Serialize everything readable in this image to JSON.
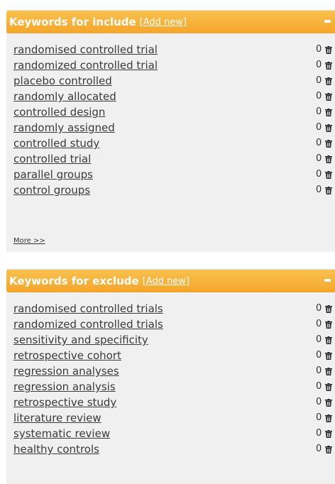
{
  "include_panel": {
    "title": "Keywords for include",
    "add_new_label": "Add new",
    "more_label": "More >>",
    "keywords": [
      {
        "label": "randomised controlled trial",
        "count": "0"
      },
      {
        "label": "randomized controlled trial",
        "count": "0"
      },
      {
        "label": "placebo controlled",
        "count": "0"
      },
      {
        "label": "randomly allocated",
        "count": "0"
      },
      {
        "label": "controlled design",
        "count": "0"
      },
      {
        "label": "randomly assigned",
        "count": "0"
      },
      {
        "label": "controlled study",
        "count": "0"
      },
      {
        "label": "controlled trial",
        "count": "0"
      },
      {
        "label": "parallel groups",
        "count": "0"
      },
      {
        "label": "control groups",
        "count": "0"
      }
    ]
  },
  "exclude_panel": {
    "title": "Keywords for exclude",
    "add_new_label": "Add new",
    "keywords": [
      {
        "label": "randomised controlled trials",
        "count": "0"
      },
      {
        "label": "randomized controlled trials",
        "count": "0"
      },
      {
        "label": "sensitivity and specificity",
        "count": "0"
      },
      {
        "label": "retrospective cohort",
        "count": "0"
      },
      {
        "label": "regression analyses",
        "count": "0"
      },
      {
        "label": "regression analysis",
        "count": "0"
      },
      {
        "label": "retrospective study",
        "count": "0"
      },
      {
        "label": "literature review",
        "count": "0"
      },
      {
        "label": "systematic review",
        "count": "0"
      },
      {
        "label": "healthy controls",
        "count": "0"
      }
    ]
  },
  "icons": {
    "delete": "trash-icon",
    "collapse": "minus-icon"
  },
  "colors": {
    "header_top": "#f9c14e",
    "header_bottom": "#f4a52a",
    "panel_bg": "#f0f0f0",
    "link_text": "#3a3a3a"
  }
}
